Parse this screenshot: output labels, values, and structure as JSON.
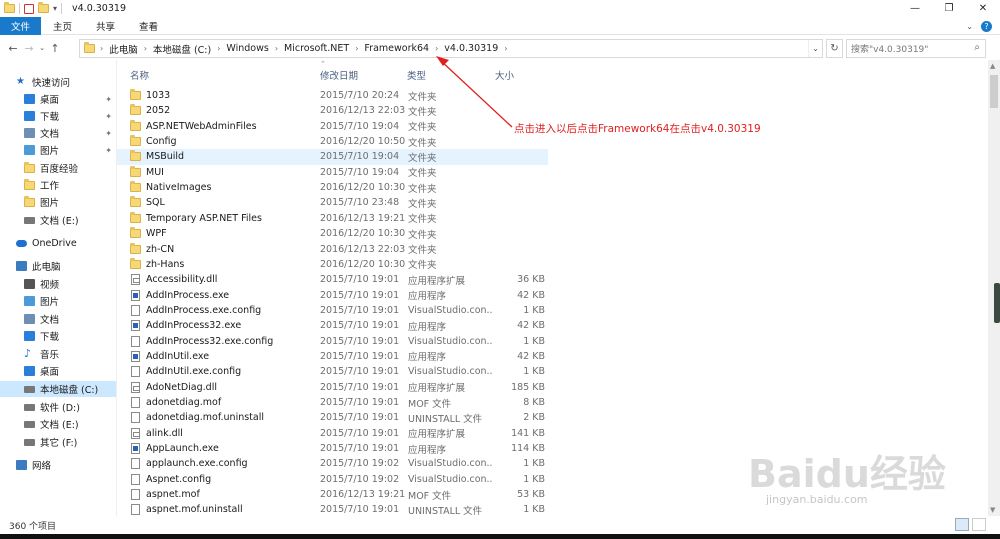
{
  "window": {
    "title": "v4.0.30319",
    "controls": {
      "minimize": "—",
      "maximize": "❐",
      "close": "✕"
    }
  },
  "ribbon": {
    "tabs": [
      "文件",
      "主页",
      "共享",
      "查看"
    ]
  },
  "address": {
    "crumbs": [
      "此电脑",
      "本地磁盘 (C:)",
      "Windows",
      "Microsoft.NET",
      "Framework64",
      "v4.0.30319"
    ],
    "search_placeholder": "搜索\"v4.0.30319\""
  },
  "sidebar": {
    "items": [
      {
        "label": "快速访问",
        "icon": "star-icon",
        "color": "#1e6fd0"
      },
      {
        "label": "桌面",
        "icon": "desktop-icon",
        "color": "#2a7fd9",
        "pinned": true
      },
      {
        "label": "下载",
        "icon": "download-icon",
        "color": "#2a7fd9",
        "pinned": true
      },
      {
        "label": "文档",
        "icon": "document-icon",
        "color": "#6d8fb3",
        "pinned": true
      },
      {
        "label": "图片",
        "icon": "picture-icon",
        "color": "#4a9bd8",
        "pinned": true
      },
      {
        "label": "百度经验",
        "icon": "folder-icon"
      },
      {
        "label": "工作",
        "icon": "folder-icon"
      },
      {
        "label": "图片",
        "icon": "folder-icon"
      },
      {
        "label": "文档 (E:)",
        "icon": "drive-icon",
        "color": "#777777"
      },
      {
        "label": "OneDrive",
        "icon": "cloud-icon",
        "color": "#1e6fd0"
      },
      {
        "label": "此电脑",
        "icon": "computer-icon",
        "color": "#3b7bbf"
      },
      {
        "label": "视频",
        "icon": "video-icon",
        "color": "#555555"
      },
      {
        "label": "图片",
        "icon": "picture-icon",
        "color": "#4a9bd8"
      },
      {
        "label": "文档",
        "icon": "document-icon",
        "color": "#6d8fb3"
      },
      {
        "label": "下载",
        "icon": "download-icon",
        "color": "#2a7fd9"
      },
      {
        "label": "音乐",
        "icon": "music-icon",
        "color": "#1e6fd0"
      },
      {
        "label": "桌面",
        "icon": "desktop-icon",
        "color": "#2a7fd9"
      },
      {
        "label": "本地磁盘 (C:)",
        "icon": "drive-icon",
        "color": "#777777",
        "selected": true
      },
      {
        "label": "软件 (D:)",
        "icon": "drive-icon",
        "color": "#777777"
      },
      {
        "label": "文档 (E:)",
        "icon": "drive-icon",
        "color": "#777777"
      },
      {
        "label": "其它 (F:)",
        "icon": "drive-icon",
        "color": "#777777"
      },
      {
        "label": "网络",
        "icon": "network-icon",
        "color": "#3b7bbf"
      }
    ]
  },
  "columns": {
    "name": "名称",
    "date": "修改日期",
    "type": "类型",
    "size": "大小"
  },
  "files": [
    {
      "name": "1033",
      "date": "2015/7/10 20:24",
      "type": "文件夹",
      "size": "",
      "kind": "folder"
    },
    {
      "name": "2052",
      "date": "2016/12/13 22:03",
      "type": "文件夹",
      "size": "",
      "kind": "folder"
    },
    {
      "name": "ASP.NETWebAdminFiles",
      "date": "2015/7/10 19:04",
      "type": "文件夹",
      "size": "",
      "kind": "folder"
    },
    {
      "name": "Config",
      "date": "2016/12/20 10:50",
      "type": "文件夹",
      "size": "",
      "kind": "folder"
    },
    {
      "name": "MSBuild",
      "date": "2015/7/10 19:04",
      "type": "文件夹",
      "size": "",
      "kind": "folder",
      "highlight": true
    },
    {
      "name": "MUI",
      "date": "2015/7/10 19:04",
      "type": "文件夹",
      "size": "",
      "kind": "folder"
    },
    {
      "name": "NativeImages",
      "date": "2016/12/20 10:30",
      "type": "文件夹",
      "size": "",
      "kind": "folder"
    },
    {
      "name": "SQL",
      "date": "2015/7/10 23:48",
      "type": "文件夹",
      "size": "",
      "kind": "folder"
    },
    {
      "name": "Temporary ASP.NET Files",
      "date": "2016/12/13 19:21",
      "type": "文件夹",
      "size": "",
      "kind": "folder"
    },
    {
      "name": "WPF",
      "date": "2016/12/20 10:30",
      "type": "文件夹",
      "size": "",
      "kind": "folder"
    },
    {
      "name": "zh-CN",
      "date": "2016/12/13 22:03",
      "type": "文件夹",
      "size": "",
      "kind": "folder"
    },
    {
      "name": "zh-Hans",
      "date": "2016/12/20 10:30",
      "type": "文件夹",
      "size": "",
      "kind": "folder"
    },
    {
      "name": "Accessibility.dll",
      "date": "2015/7/10 19:01",
      "type": "应用程序扩展",
      "size": "36 KB",
      "kind": "dll"
    },
    {
      "name": "AddInProcess.exe",
      "date": "2015/7/10 19:01",
      "type": "应用程序",
      "size": "42 KB",
      "kind": "exe"
    },
    {
      "name": "AddInProcess.exe.config",
      "date": "2015/7/10 19:01",
      "type": "VisualStudio.con...",
      "size": "1 KB",
      "kind": "file"
    },
    {
      "name": "AddInProcess32.exe",
      "date": "2015/7/10 19:01",
      "type": "应用程序",
      "size": "42 KB",
      "kind": "exe"
    },
    {
      "name": "AddInProcess32.exe.config",
      "date": "2015/7/10 19:01",
      "type": "VisualStudio.con...",
      "size": "1 KB",
      "kind": "file"
    },
    {
      "name": "AddInUtil.exe",
      "date": "2015/7/10 19:01",
      "type": "应用程序",
      "size": "42 KB",
      "kind": "exe"
    },
    {
      "name": "AddInUtil.exe.config",
      "date": "2015/7/10 19:01",
      "type": "VisualStudio.con...",
      "size": "1 KB",
      "kind": "file"
    },
    {
      "name": "AdoNetDiag.dll",
      "date": "2015/7/10 19:01",
      "type": "应用程序扩展",
      "size": "185 KB",
      "kind": "dll"
    },
    {
      "name": "adonetdiag.mof",
      "date": "2015/7/10 19:01",
      "type": "MOF 文件",
      "size": "8 KB",
      "kind": "file"
    },
    {
      "name": "adonetdiag.mof.uninstall",
      "date": "2015/7/10 19:01",
      "type": "UNINSTALL 文件",
      "size": "2 KB",
      "kind": "file"
    },
    {
      "name": "alink.dll",
      "date": "2015/7/10 19:01",
      "type": "应用程序扩展",
      "size": "141 KB",
      "kind": "dll"
    },
    {
      "name": "AppLaunch.exe",
      "date": "2015/7/10 19:01",
      "type": "应用程序",
      "size": "114 KB",
      "kind": "exe"
    },
    {
      "name": "applaunch.exe.config",
      "date": "2015/7/10 19:02",
      "type": "VisualStudio.con...",
      "size": "1 KB",
      "kind": "file"
    },
    {
      "name": "Aspnet.config",
      "date": "2015/7/10 19:02",
      "type": "VisualStudio.con...",
      "size": "1 KB",
      "kind": "file"
    },
    {
      "name": "aspnet.mof",
      "date": "2016/12/13 19:21",
      "type": "MOF 文件",
      "size": "53 KB",
      "kind": "file"
    },
    {
      "name": "aspnet.mof.uninstall",
      "date": "2015/7/10 19:01",
      "type": "UNINSTALL 文件",
      "size": "1 KB",
      "kind": "file"
    }
  ],
  "status": {
    "count": "360 个项目"
  },
  "annotation": {
    "text": "点击进入以后点击Framework64在点击v4.0.30319",
    "color": "#e02020"
  },
  "watermark": {
    "logo": "Baidu经验",
    "url": "jingyan.baidu.com"
  },
  "colors": {
    "accent": "#1979ca",
    "selected": "#cce8ff",
    "hover": "#e5f3ff",
    "folder": "#f8d775"
  }
}
